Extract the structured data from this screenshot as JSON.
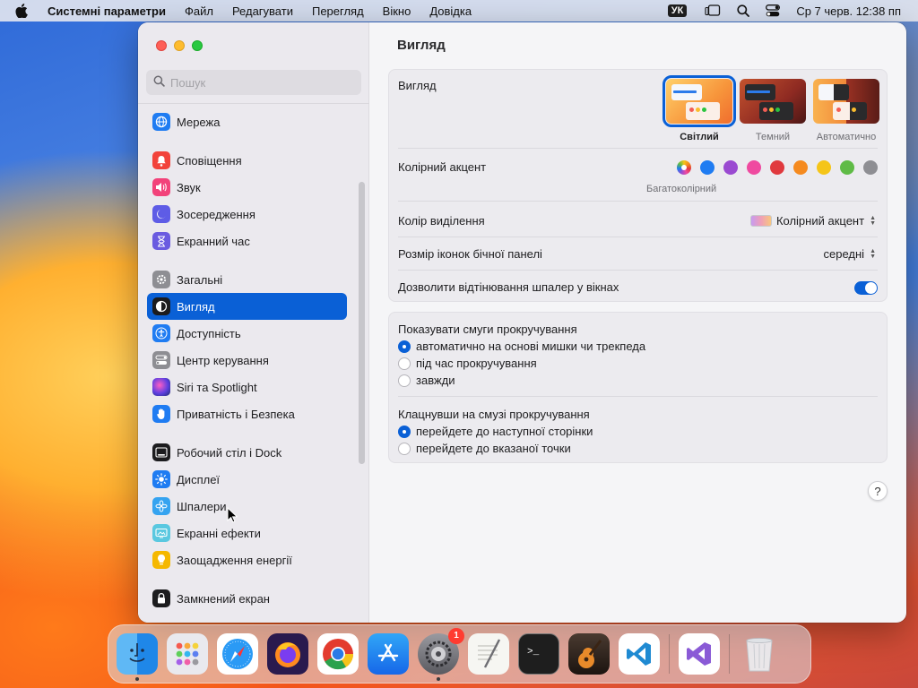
{
  "menubar": {
    "app_name": "Системні параметри",
    "items": [
      "Файл",
      "Редагувати",
      "Перегляд",
      "Вікно",
      "Довідка"
    ],
    "input_source": "УК",
    "clock": "Ср 7 черв.  12:38 пп"
  },
  "window": {
    "search": {
      "placeholder": "Пошук"
    },
    "sidebar": {
      "items": [
        {
          "label": "Мережа",
          "icon": "globe-icon",
          "color": "#1f7cf2"
        },
        {
          "label": "Сповіщення",
          "icon": "bell-icon",
          "color": "#f2423a"
        },
        {
          "label": "Звук",
          "icon": "speaker-icon",
          "color": "#f2427a"
        },
        {
          "label": "Зосередження",
          "icon": "moon-icon",
          "color": "#5e5ce6"
        },
        {
          "label": "Екранний час",
          "icon": "hourglass-icon",
          "color": "#6a5be0"
        },
        {
          "label": "Загальні",
          "icon": "gear-icon",
          "color": "#8e8e93"
        },
        {
          "label": "Вигляд",
          "icon": "appearance-icon",
          "color": "#1c1c1e",
          "active": true
        },
        {
          "label": "Доступність",
          "icon": "accessibility-icon",
          "color": "#1f7cf2"
        },
        {
          "label": "Центр керування",
          "icon": "control-center-icon",
          "color": "#8e8e93"
        },
        {
          "label": "Siri та Spotlight",
          "icon": "siri-icon",
          "color": "#2b2b6e"
        },
        {
          "label": "Приватність і Безпека",
          "icon": "hand-icon",
          "color": "#1f7cf2"
        },
        {
          "label": "Робочий стіл і Dock",
          "icon": "dock-icon",
          "color": "#1c1c1e"
        },
        {
          "label": "Дисплеї",
          "icon": "sun-icon",
          "color": "#1f7cf2"
        },
        {
          "label": "Шпалери",
          "icon": "flower-icon",
          "color": "#35a3f0"
        },
        {
          "label": "Екранні ефекти",
          "icon": "screensaver-icon",
          "color": "#5ac8e0"
        },
        {
          "label": "Заощадження енергії",
          "icon": "bulb-icon",
          "color": "#f5b800"
        },
        {
          "label": "Замкнений екран",
          "icon": "lock-icon",
          "color": "#1c1c1e"
        }
      ]
    },
    "content": {
      "title": "Вигляд",
      "appearance": {
        "label": "Вигляд",
        "options": [
          "Світлий",
          "Темний",
          "Автоматично"
        ],
        "selected": "Світлий"
      },
      "accent": {
        "label": "Колірний акцент",
        "caption": "Багатоколірний",
        "colors": [
          "#1f7cf2",
          "#9a4ad1",
          "#ef4aa0",
          "#e0393e",
          "#f58a1f",
          "#f5c518",
          "#5fbb46",
          "#8e8e93"
        ]
      },
      "highlight": {
        "label": "Колір виділення",
        "value": "Колірний акцент"
      },
      "icon_size": {
        "label": "Розмір іконок бічної панелі",
        "value": "середні"
      },
      "wallpaper_tint": {
        "label": "Дозволити відтінювання шпалер у вікнах",
        "enabled": true
      },
      "scrollbars": {
        "title": "Показувати смуги прокручування",
        "options": [
          "автоматично на основі мишки чи трекпеда",
          "під час прокручування",
          "завжди"
        ],
        "selected": 0
      },
      "scroll_click": {
        "title": "Клацнувши на смузі прокручування",
        "options": [
          "перейдете до наступної сторінки",
          "перейдете до вказаної точки"
        ],
        "selected": 0
      },
      "help": "?"
    }
  },
  "dock": {
    "settings_badge": "1",
    "apps": [
      "finder-icon",
      "launchpad-icon",
      "safari-icon",
      "firefox-icon",
      "chrome-icon",
      "app-store-icon",
      "system-settings-icon",
      "textedit-icon",
      "terminal-icon",
      "garageband-icon",
      "vscode-icon",
      "visual-studio-icon",
      "trash-icon"
    ]
  }
}
